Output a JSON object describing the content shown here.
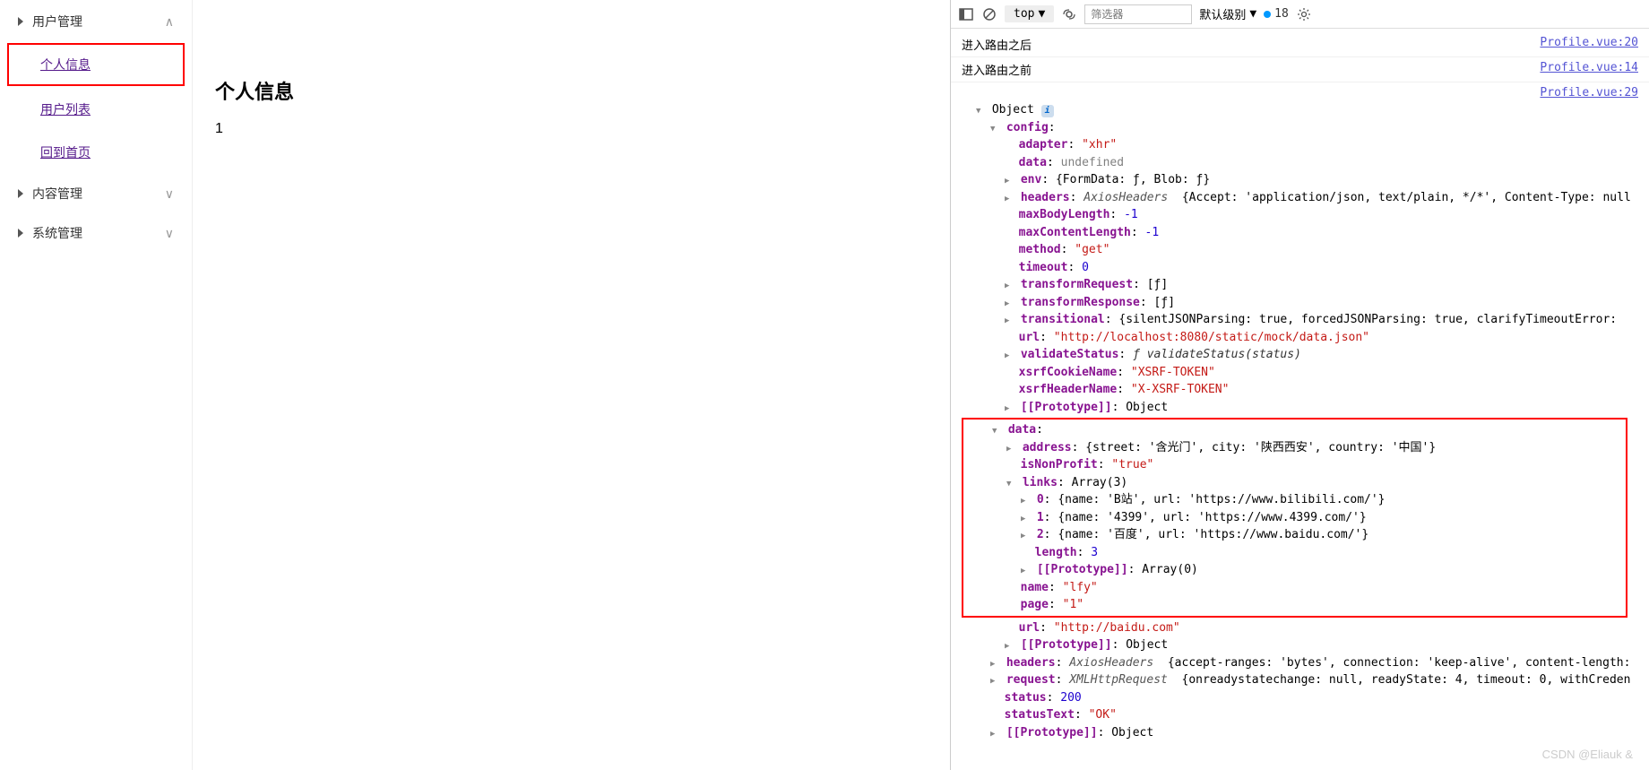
{
  "sidebar": {
    "items": [
      {
        "label": "用户管理",
        "expanded": true
      },
      {
        "label": "个人信息",
        "type": "sub",
        "selected": true
      },
      {
        "label": "用户列表",
        "type": "sub"
      },
      {
        "label": "回到首页",
        "type": "sub"
      },
      {
        "label": "内容管理",
        "expanded": false
      },
      {
        "label": "系统管理",
        "expanded": false
      }
    ]
  },
  "content": {
    "title": "个人信息",
    "body": "1"
  },
  "devtools": {
    "toolbar": {
      "top": "top",
      "filter_placeholder": "筛选器",
      "level": "默认级别",
      "issues": "18"
    },
    "logs": [
      {
        "msg": "进入路由之后",
        "src": "Profile.vue:20"
      },
      {
        "msg": "进入路由之前",
        "src": "Profile.vue:14"
      }
    ],
    "obj_src": "Profile.vue:29",
    "tree": {
      "root": "Object",
      "config_label": "config",
      "adapter": {
        "k": "adapter",
        "v": "\"xhr\""
      },
      "data_undef": {
        "k": "data",
        "v": "undefined"
      },
      "env": {
        "k": "env",
        "preview": "{FormData: ƒ, Blob: ƒ}"
      },
      "headers": {
        "k": "headers",
        "cls": "AxiosHeaders",
        "preview": "{Accept: 'application/json, text/plain, */*', Content-Type: null"
      },
      "maxBodyLength": {
        "k": "maxBodyLength",
        "v": "-1"
      },
      "maxContentLength": {
        "k": "maxContentLength",
        "v": "-1"
      },
      "method": {
        "k": "method",
        "v": "\"get\""
      },
      "timeout": {
        "k": "timeout",
        "v": "0"
      },
      "transformRequest": {
        "k": "transformRequest",
        "preview": "[ƒ]"
      },
      "transformResponse": {
        "k": "transformResponse",
        "preview": "[ƒ]"
      },
      "transitional": {
        "k": "transitional",
        "preview": "{silentJSONParsing: true, forcedJSONParsing: true, clarifyTimeoutError: "
      },
      "url": {
        "k": "url",
        "v": "\"http://localhost:8080/static/mock/data.json\""
      },
      "validateStatus": {
        "k": "validateStatus",
        "preview": "ƒ validateStatus(status)"
      },
      "xsrfCookieName": {
        "k": "xsrfCookieName",
        "v": "\"XSRF-TOKEN\""
      },
      "xsrfHeaderName": {
        "k": "xsrfHeaderName",
        "v": "\"X-XSRF-TOKEN\""
      },
      "proto1": {
        "k": "[[Prototype]]",
        "v": "Object"
      },
      "data_label": "data",
      "address": {
        "k": "address",
        "preview": "{street: '含光门', city: '陕西西安', country: '中国'}"
      },
      "isNonProfit": {
        "k": "isNonProfit",
        "v": "\"true\""
      },
      "links_label": {
        "k": "links",
        "v": "Array(3)"
      },
      "link0": {
        "k": "0",
        "preview": "{name: 'B站', url: 'https://www.bilibili.com/'}"
      },
      "link1": {
        "k": "1",
        "preview": "{name: '4399', url: 'https://www.4399.com/'}"
      },
      "link2": {
        "k": "2",
        "preview": "{name: '百度', url: 'https://www.baidu.com/'}"
      },
      "length": {
        "k": "length",
        "v": "3"
      },
      "proto_arr": {
        "k": "[[Prototype]]",
        "v": "Array(0)"
      },
      "name": {
        "k": "name",
        "v": "\"lfy\""
      },
      "page": {
        "k": "page",
        "v": "\"1\""
      },
      "url2": {
        "k": "url",
        "v": "\"http://baidu.com\""
      },
      "proto2": {
        "k": "[[Prototype]]",
        "v": "Object"
      },
      "headers2": {
        "k": "headers",
        "cls": "AxiosHeaders",
        "preview": "{accept-ranges: 'bytes', connection: 'keep-alive', content-length:"
      },
      "request": {
        "k": "request",
        "cls": "XMLHttpRequest",
        "preview": "{onreadystatechange: null, readyState: 4, timeout: 0, withCreden"
      },
      "status": {
        "k": "status",
        "v": "200"
      },
      "statusText": {
        "k": "statusText",
        "v": "\"OK\""
      },
      "proto3": {
        "k": "[[Prototype]]",
        "v": "Object"
      }
    }
  },
  "watermark": "CSDN @Eliauk &"
}
